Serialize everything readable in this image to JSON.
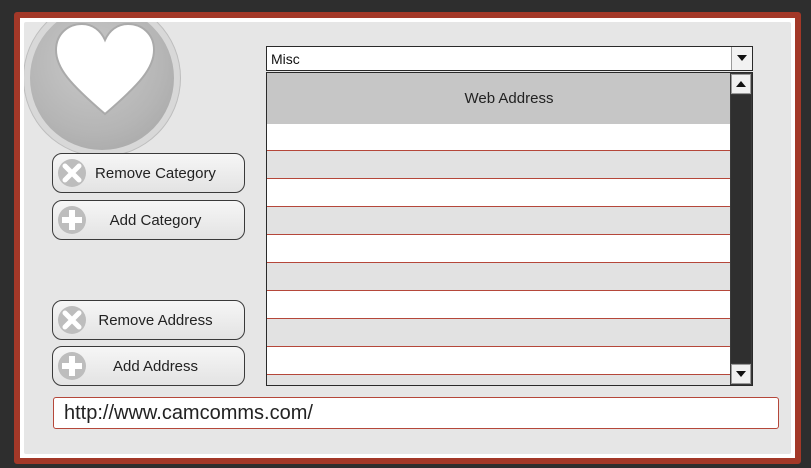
{
  "category": {
    "selected": "Misc"
  },
  "table": {
    "header": "Web Address",
    "row_count": 10
  },
  "buttons": {
    "remove_category": "Remove Category",
    "add_category": "Add Category",
    "remove_address": "Remove Address",
    "add_address": "Add Address"
  },
  "url_field": {
    "value": "http://www.camcomms.com/"
  },
  "icons": {
    "logo": "heart-icon",
    "remove": "remove-icon",
    "add": "plus-icon",
    "dropdown": "chevron-down-icon",
    "scroll_up": "arrow-up-icon",
    "scroll_down": "arrow-down-icon"
  },
  "colors": {
    "accent": "#a33828",
    "row_divider": "#b5473a",
    "header_bg": "#c6c6c6",
    "scrollbar": "#3a3a3a"
  }
}
